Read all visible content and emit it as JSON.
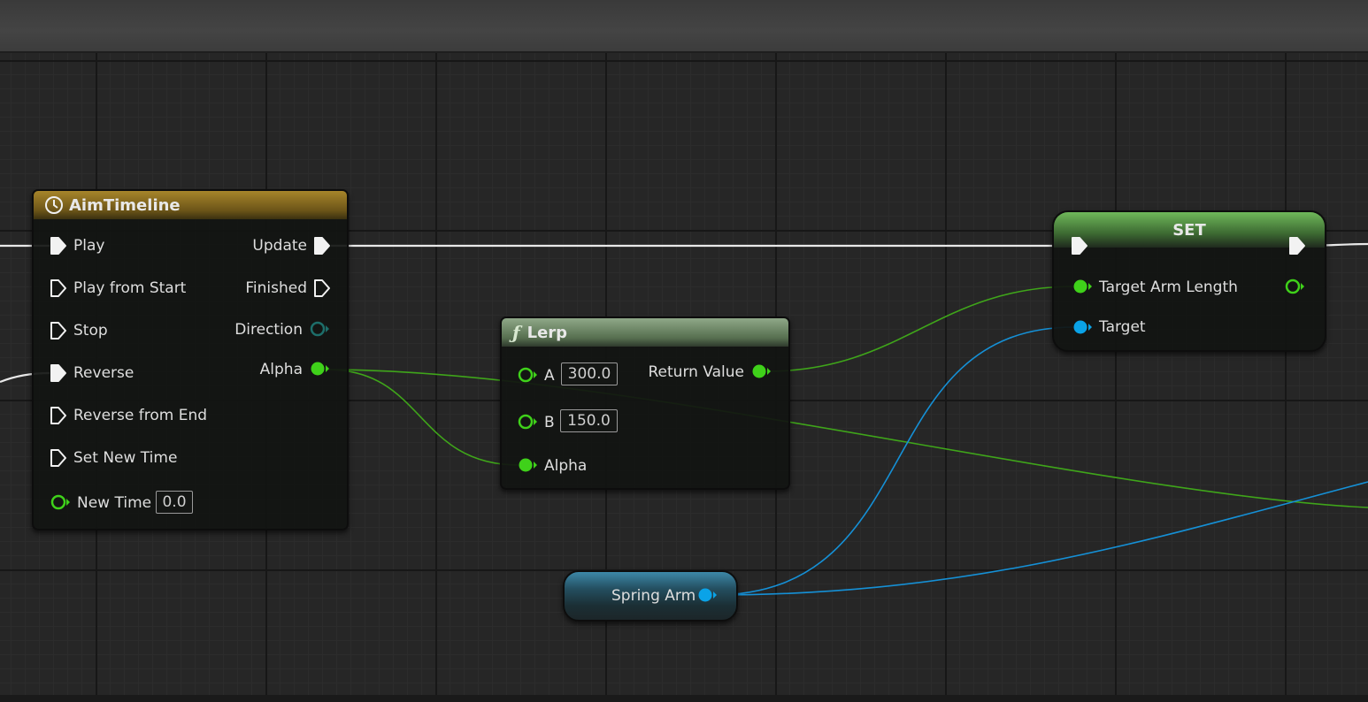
{
  "timeline_node": {
    "title": "AimTimeline",
    "inputs": [
      "Play",
      "Play from Start",
      "Stop",
      "Reverse",
      "Reverse from End",
      "Set New Time"
    ],
    "new_time_label": "New Time",
    "new_time_value": "0.0",
    "outputs": [
      "Update",
      "Finished",
      "Direction",
      "Alpha"
    ]
  },
  "lerp_node": {
    "title": "Lerp",
    "a_label": "A",
    "a_value": "300.0",
    "b_label": "B",
    "b_value": "150.0",
    "alpha_label": "Alpha",
    "return_label": "Return Value"
  },
  "set_node": {
    "title": "SET",
    "target_arm_length_label": "Target Arm Length",
    "target_label": "Target"
  },
  "spring_arm_node": {
    "label": "Spring Arm"
  },
  "colors": {
    "exec_wire": "#ffffff",
    "float_pin": "#3fd11a",
    "object_pin": "#0aa3e8",
    "timeline_header": "#8a6d1c",
    "function_header": "#5c7a52",
    "set_header": "#4e8a3c"
  },
  "icons": [
    "clock-icon",
    "function-icon",
    "exec-pin",
    "float-pin",
    "object-pin",
    "struct-pin"
  ]
}
